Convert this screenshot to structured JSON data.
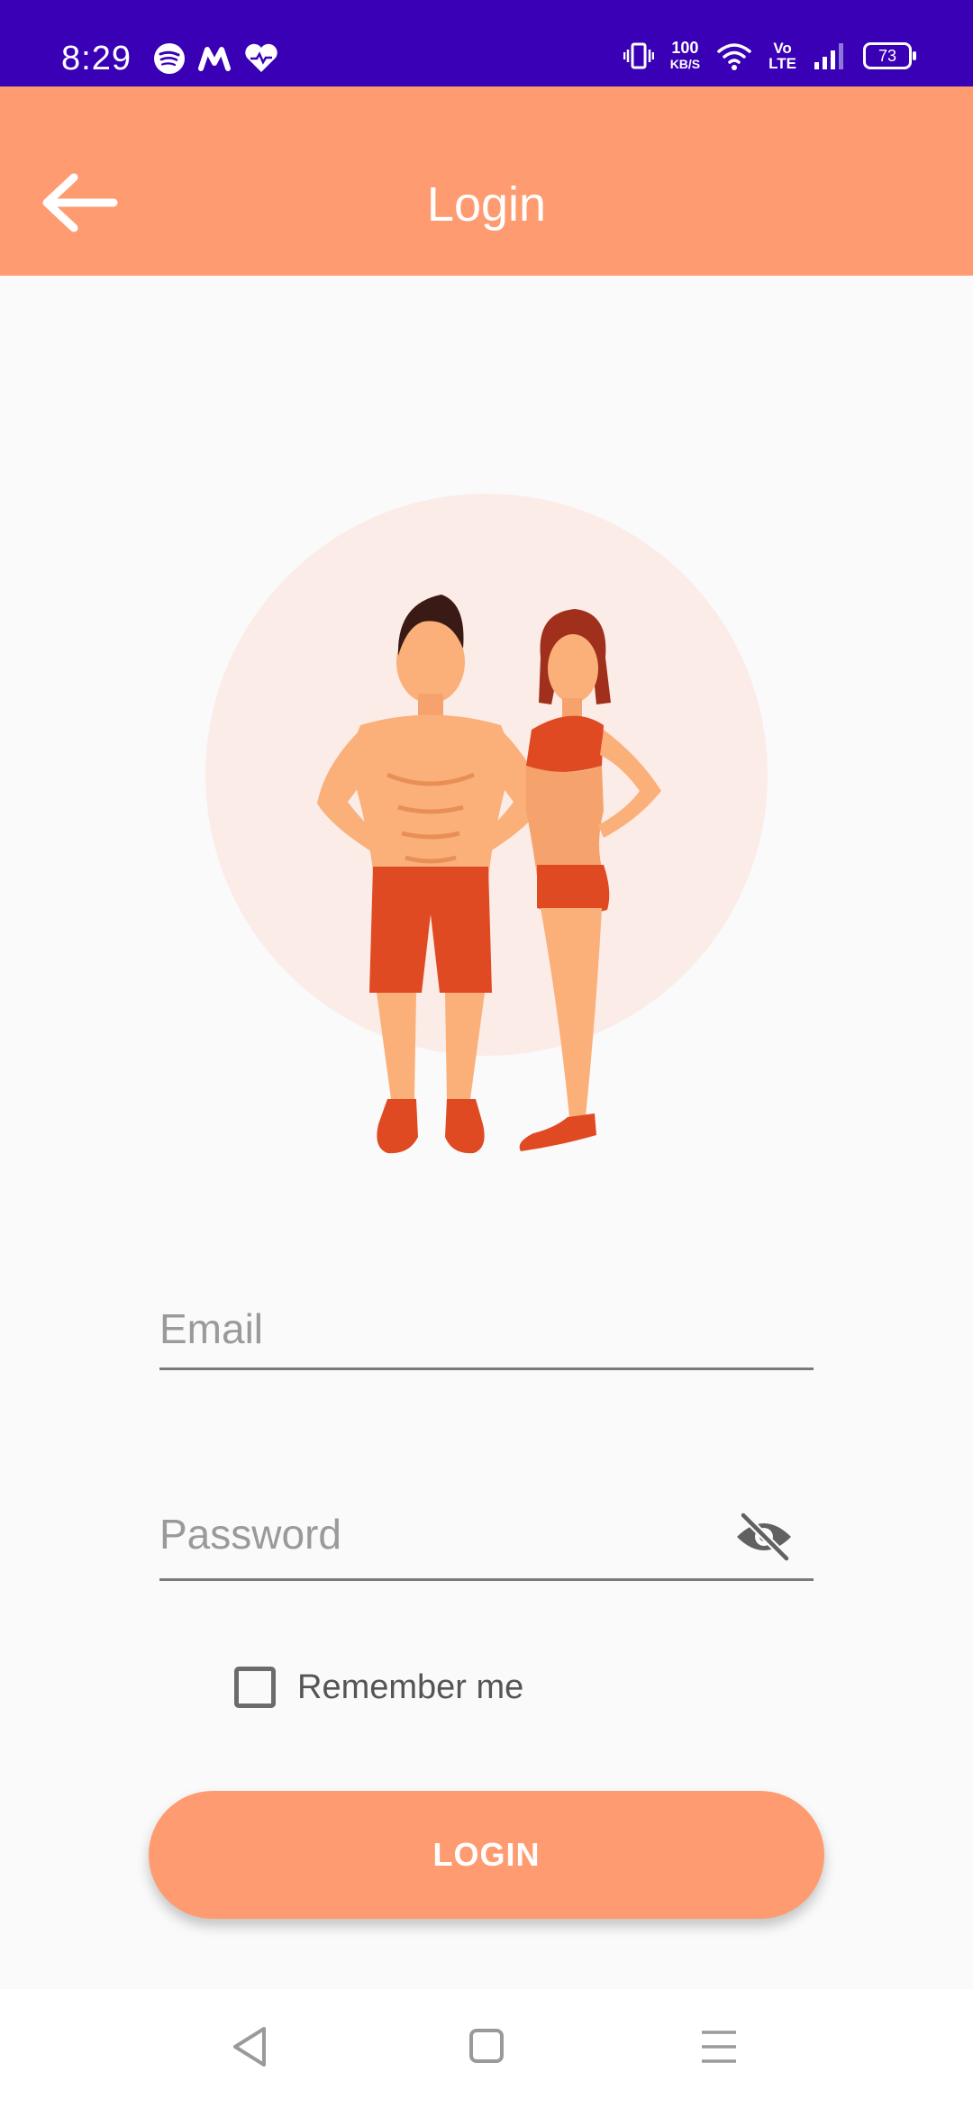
{
  "status_bar": {
    "time": "8:29",
    "net_speed_value": "100",
    "net_speed_unit": "KB/S",
    "volte_top": "Vo",
    "volte_bottom": "LTE",
    "battery": "73",
    "icons": [
      "spotify-icon",
      "m-app-icon",
      "heart-icon",
      "vibrate-icon",
      "wifi-icon",
      "signal-icon",
      "battery-icon"
    ]
  },
  "app_bar": {
    "title": "Login",
    "back_icon": "arrow-left-icon",
    "color": "#ff9b70"
  },
  "form": {
    "email_placeholder": "Email",
    "email_value": "",
    "password_placeholder": "Password",
    "password_value": "",
    "password_toggle_icon": "eye-off-icon",
    "remember_label": "Remember me",
    "remember_checked": false,
    "login_label": "LOGIN"
  },
  "nav_bar": {
    "icons": [
      "back-triangle-icon",
      "home-square-icon",
      "menu-lines-icon"
    ]
  },
  "colors": {
    "status_bar": "#3a00b6",
    "accent": "#ff9b70",
    "background": "#fafafa",
    "hero_circle": "#fbece8"
  }
}
